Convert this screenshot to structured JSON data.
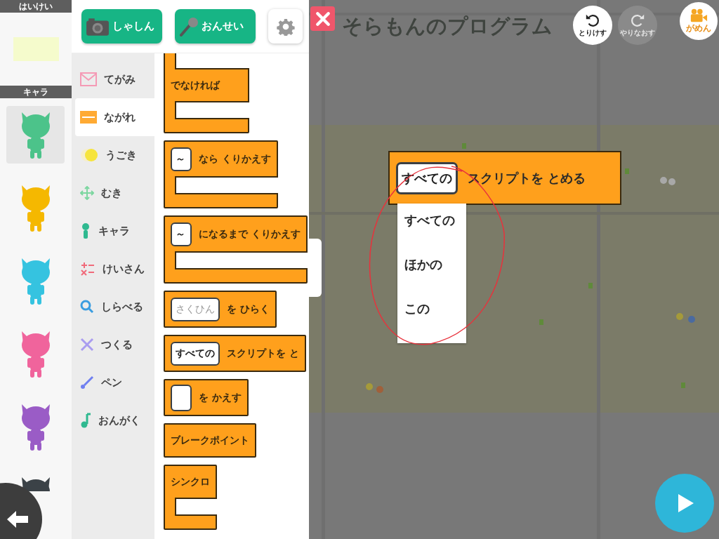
{
  "left_panel": {
    "background_header": "はいけい",
    "characters_header": "キャラ",
    "characters": [
      {
        "color": "#4cc38a",
        "selected": true
      },
      {
        "color": "#f5b800",
        "selected": false
      },
      {
        "color": "#35c3e0",
        "selected": false
      },
      {
        "color": "#f0649c",
        "selected": false
      },
      {
        "color": "#9a5cc6",
        "selected": false
      },
      {
        "color": "#3b4247",
        "selected": false
      }
    ]
  },
  "toolbar": {
    "buttons": [
      {
        "label": "しゃしん"
      },
      {
        "kind": "sound",
        "label": "おんせい"
      },
      {
        "kind": "settings"
      }
    ]
  },
  "categories": [
    {
      "label": "てがみ",
      "selected": false
    },
    {
      "label": "ながれ",
      "selected": true
    },
    {
      "label": "うごき",
      "selected": false
    },
    {
      "label": "むき",
      "selected": false
    },
    {
      "label": "キャラ",
      "selected": false
    },
    {
      "label": "けいさん",
      "selected": false
    },
    {
      "label": "しらべる",
      "selected": false
    },
    {
      "label": "つくる",
      "selected": false
    },
    {
      "label": "ペン",
      "selected": false
    },
    {
      "label": "おんがく",
      "selected": false
    }
  ],
  "palette": [
    {
      "kind": "else",
      "label": "でなければ"
    },
    {
      "kind": "c",
      "slot": {
        "kind": "value",
        "text": "～"
      },
      "label": "なら くりかえす"
    },
    {
      "kind": "c",
      "slot": {
        "kind": "value",
        "text": "～"
      },
      "label": "になるまで くりかえす"
    },
    {
      "kind": "plain",
      "slot": {
        "kind": "placeholder",
        "text": "さくひん"
      },
      "label": "を ひらく"
    },
    {
      "kind": "plain",
      "slot": {
        "kind": "value",
        "text": "すべての"
      },
      "label": "スクリプトを と"
    },
    {
      "kind": "plain",
      "slot": {
        "kind": "empty"
      },
      "label": "を かえす"
    },
    {
      "kind": "plain",
      "label": "ブレークポイント"
    },
    {
      "kind": "c",
      "label": "シンクロ"
    }
  ],
  "stage": {
    "title": "そらもんのプログラム",
    "history_buttons": [
      {
        "kind": "undo",
        "label": "とりけす",
        "disabled": false
      },
      {
        "kind": "redo",
        "label": "やりなおす",
        "disabled": true
      }
    ],
    "screen_button": "がめん",
    "block": {
      "slot": "すべての",
      "label": "スクリプトを とめる"
    },
    "dropdown": [
      {
        "label": "すべての",
        "selected": false
      },
      {
        "label": "ほかの",
        "selected": false
      },
      {
        "label": "この",
        "selected": false
      }
    ]
  }
}
